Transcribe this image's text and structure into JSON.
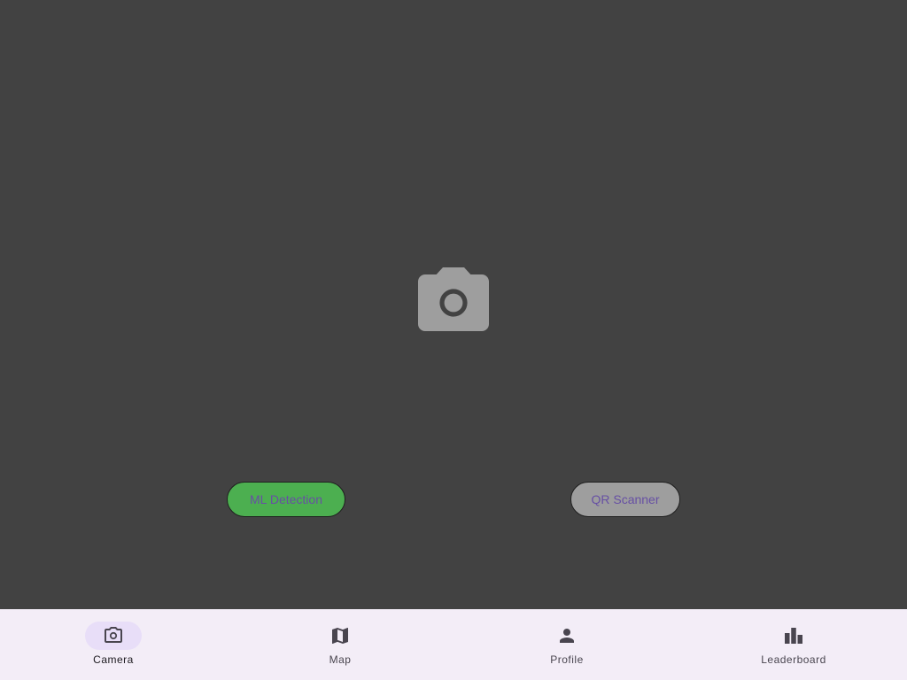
{
  "camera": {
    "placeholder_icon": "photo-camera-icon",
    "placeholder_color": "#9e9e9e",
    "background": "#424242"
  },
  "buttons": {
    "ml_detection": {
      "label": "ML Detection",
      "background": "#4caf50",
      "text_color": "#6750a4",
      "selected": true
    },
    "qr_scanner": {
      "label": "QR Scanner",
      "background": "#9e9e9e",
      "text_color": "#6750a4",
      "selected": false
    }
  },
  "nav": {
    "background": "#f3edf7",
    "indicator_color": "#e8def8",
    "items": [
      {
        "label": "Camera",
        "icon": "camera-icon",
        "active": true
      },
      {
        "label": "Map",
        "icon": "map-icon",
        "active": false
      },
      {
        "label": "Profile",
        "icon": "person-icon",
        "active": false
      },
      {
        "label": "Leaderboard",
        "icon": "leaderboard-icon",
        "active": false
      }
    ]
  }
}
